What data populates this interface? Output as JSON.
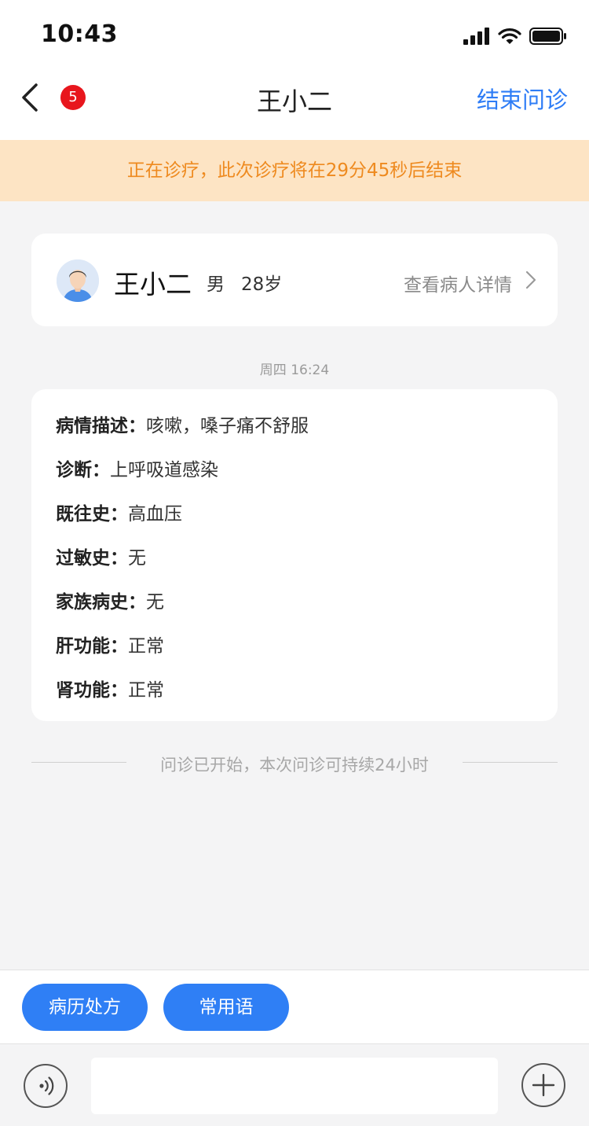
{
  "status_bar": {
    "time": "10:43"
  },
  "nav": {
    "badge_count": "5",
    "title": "王小二",
    "end_label": "结束问诊"
  },
  "banner": {
    "text": "正在诊疗，此次诊疗将在29分45秒后结束"
  },
  "patient": {
    "name": "王小二",
    "gender": "男",
    "age": "28岁",
    "detail_link": "查看病人详情"
  },
  "timestamp": "周四 16:24",
  "info": [
    {
      "label": "病情描述：",
      "value": "咳嗽，嗓子痛不舒服"
    },
    {
      "label": "诊断：",
      "value": "上呼吸道感染"
    },
    {
      "label": "既往史：",
      "value": "高血压"
    },
    {
      "label": "过敏史：",
      "value": "无"
    },
    {
      "label": "家族病史：",
      "value": "无"
    },
    {
      "label": "肝功能：",
      "value": "正常"
    },
    {
      "label": "肾功能：",
      "value": "正常"
    }
  ],
  "notice": "问诊已开始，本次问诊可持续24小时",
  "quick_buttons": [
    {
      "label": "病历处方"
    },
    {
      "label": "常用语"
    }
  ],
  "input": {
    "placeholder": ""
  },
  "colors": {
    "accent": "#2f7ff5",
    "banner_bg": "#fde4c4",
    "banner_text": "#ee8a1f",
    "badge": "#e8161d"
  }
}
